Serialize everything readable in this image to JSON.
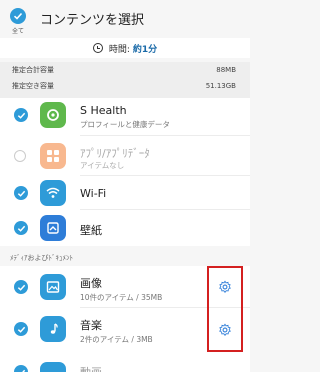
{
  "header": {
    "select_all_label": "全て",
    "title": "コンテンツを選択"
  },
  "time": {
    "label": "時間:",
    "value": "約1分"
  },
  "stats": [
    {
      "label": "推定合計容量",
      "value": "88MB"
    },
    {
      "label": "推定空き容量",
      "value": "51.13GB"
    }
  ],
  "items": [
    {
      "title": "S Health",
      "subtitle": "プロフィールと健康データ",
      "checked": true,
      "icon": "s-health-icon",
      "color": "#4caf50"
    },
    {
      "title": "ｱﾌﾟﾘ/ｱﾌﾟﾘﾃﾞｰﾀ",
      "subtitle": "アイテムなし",
      "checked": false,
      "icon": "apps-icon",
      "color": "#f7a877"
    },
    {
      "title": "Wi-Fi",
      "subtitle": "",
      "checked": true,
      "icon": "wifi-icon",
      "color": "#2e9bd8"
    },
    {
      "title": "壁紙",
      "subtitle": "",
      "checked": true,
      "icon": "wallpaper-icon",
      "color": "#2e7dd8"
    }
  ],
  "media_section": {
    "label": "ﾒﾃﾞｨｱおよびﾄﾞｷｭﾒﾝﾄ",
    "items": [
      {
        "title": "画像",
        "subtitle": "10件のアイテム / 35MB",
        "checked": true,
        "icon": "image-icon",
        "color": "#2e9bd8"
      },
      {
        "title": "音楽",
        "subtitle": "2件のアイテム / 3MB",
        "checked": true,
        "icon": "music-icon",
        "color": "#2e9bd8"
      },
      {
        "title": "動画",
        "subtitle": "",
        "checked": true,
        "icon": "video-icon",
        "color": "#2e9bd8"
      }
    ]
  },
  "colors": {
    "accent": "#2e9bd8",
    "highlight": "#d42020"
  }
}
